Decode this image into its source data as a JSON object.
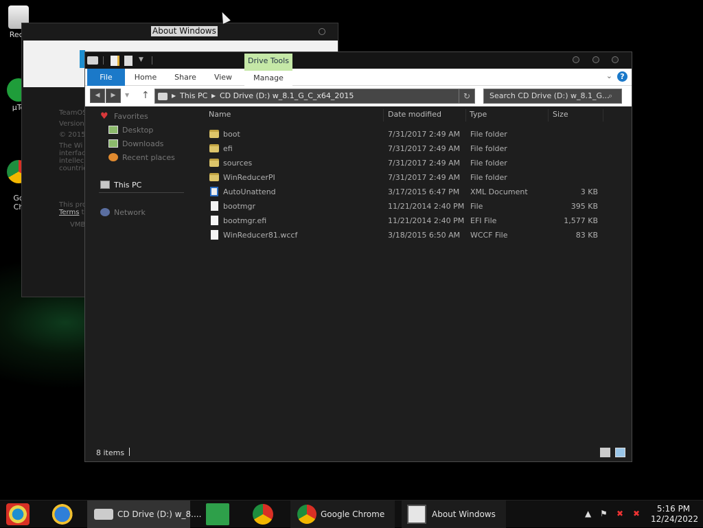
{
  "desktop": {
    "icons": [
      {
        "label": "Recy",
        "icon": "recycle-bin-icon"
      },
      {
        "label": "µTo",
        "icon": "utorrent-icon"
      },
      {
        "label": "Go\nCh",
        "icon": "google-chrome-icon"
      }
    ]
  },
  "about_window": {
    "title": "About Windows",
    "lines": [
      "TeamOS",
      "Version",
      "© 2015",
      "The Wi",
      "interfac",
      "intellec",
      "countrie"
    ],
    "license_line": "This pro",
    "terms": "Terms",
    "terms_after": " t",
    "vmb": "VMB"
  },
  "explorer": {
    "contextual_tab": "Drive Tools",
    "ribbon_tabs": [
      "File",
      "Home",
      "Share",
      "View",
      "Manage"
    ],
    "help": "?",
    "address": {
      "crumbs": [
        "This PC",
        "CD Drive (D:) w_8.1_G_C_x64_2015"
      ]
    },
    "search_placeholder": "Search CD Drive (D:) w_8.1_G...",
    "nav_pane": {
      "favorites": "Favorites",
      "favorites_items": [
        "Desktop",
        "Downloads",
        "Recent places"
      ],
      "this_pc": "This PC",
      "network": "Network"
    },
    "columns": [
      "Name",
      "Date modified",
      "Type",
      "Size"
    ],
    "files": [
      {
        "name": "boot",
        "date": "7/31/2017 2:49 AM",
        "type": "File folder",
        "size": "",
        "icon": "folder"
      },
      {
        "name": "efi",
        "date": "7/31/2017 2:49 AM",
        "type": "File folder",
        "size": "",
        "icon": "folder"
      },
      {
        "name": "sources",
        "date": "7/31/2017 2:49 AM",
        "type": "File folder",
        "size": "",
        "icon": "folder"
      },
      {
        "name": "WinReducerPI",
        "date": "7/31/2017 2:49 AM",
        "type": "File folder",
        "size": "",
        "icon": "folder"
      },
      {
        "name": "AutoUnattend",
        "date": "3/17/2015 6:47 PM",
        "type": "XML Document",
        "size": "3 KB",
        "icon": "xml"
      },
      {
        "name": "bootmgr",
        "date": "11/21/2014 2:40 PM",
        "type": "File",
        "size": "395 KB",
        "icon": "file"
      },
      {
        "name": "bootmgr.efi",
        "date": "11/21/2014 2:40 PM",
        "type": "EFI File",
        "size": "1,577 KB",
        "icon": "file"
      },
      {
        "name": "WinReducer81.wccf",
        "date": "3/18/2015 6:50 AM",
        "type": "WCCF File",
        "size": "83 KB",
        "icon": "file"
      }
    ],
    "status": "8 items"
  },
  "taskbar": {
    "apps": [
      {
        "label": "CD Drive (D:) w_8....",
        "icon": "drive-icon"
      },
      {
        "label": "Google Chrome",
        "icon": "chrome-icon"
      },
      {
        "label": "About Windows",
        "icon": "about-window-icon"
      }
    ],
    "clock_time": "5:16 PM",
    "clock_date": "12/24/2022"
  },
  "colors": {
    "accent": "#1b79c9",
    "drive_tools": "#c5e8a7",
    "folder": "#ddc56a"
  }
}
